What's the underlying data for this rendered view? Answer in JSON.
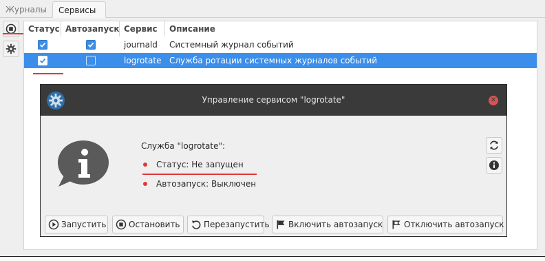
{
  "tabs": [
    {
      "label": "Журналы",
      "active": false
    },
    {
      "label": "Сервисы",
      "active": true
    }
  ],
  "sidebar": {
    "items": [
      {
        "icon": "stop-circle-icon"
      },
      {
        "icon": "gear-icon"
      }
    ]
  },
  "table": {
    "headers": [
      "Статус",
      "Автозапуск",
      "Сервис",
      "Описание"
    ],
    "rows": [
      {
        "status": true,
        "autostart": true,
        "service": "journald",
        "description": "Системный журнал событий",
        "selected": false
      },
      {
        "status": true,
        "autostart": false,
        "service": "logrotate",
        "description": "Служба ротации системных журналов событий",
        "selected": true
      }
    ]
  },
  "dialog": {
    "title": "Управление сервисом \"logrotate\"",
    "service_line": "Служба \"logrotate\":",
    "status_line": "Статус: Не запущен",
    "autostart_line": "Автозапуск: Выключен",
    "buttons": {
      "start": "Запустить",
      "stop": "Остановить",
      "restart": "Перезапустить",
      "enable_autostart": "Включить автозапуск",
      "disable_autostart": "Отключить автозапуск"
    }
  },
  "colors": {
    "accent": "#3b8eea",
    "annotation": "#e0383b",
    "titlebar": "#3a3a3a"
  }
}
